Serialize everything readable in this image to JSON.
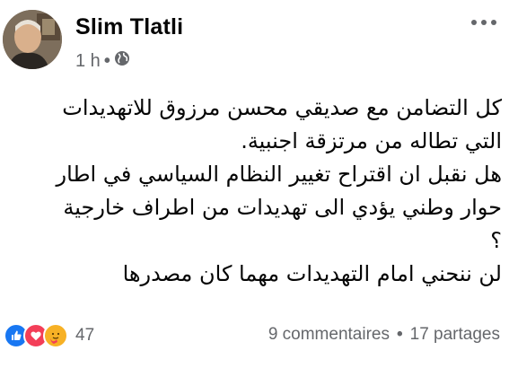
{
  "post": {
    "author": "Slim Tlatli",
    "time": "1 h",
    "meta_separator": "•",
    "audience_icon": "globe-icon",
    "lines": [
      "كل التضامن مع صديقي محسن مرزوق   للاتهديدات",
      "التي تطاله من مرتزقة اجنبية.",
      "هل نقبل ان اقتراح تغيير النظام السياسي في اطار",
      "حوار وطني يؤدي الى تهديدات من اطراف خارجية",
      "؟",
      "لن ننحني امام التهديدات مهما كان مصدرها"
    ]
  },
  "footer": {
    "reaction_icons": [
      "like-icon",
      "love-icon",
      "care-icon"
    ],
    "reaction_count": "47",
    "comments": "9 commentaires",
    "separator": "•",
    "shares": "17 partages"
  },
  "colors": {
    "secondary_text": "#65676b",
    "like": "#1877f2",
    "love": "#f33e58",
    "care": "#f7b125"
  }
}
